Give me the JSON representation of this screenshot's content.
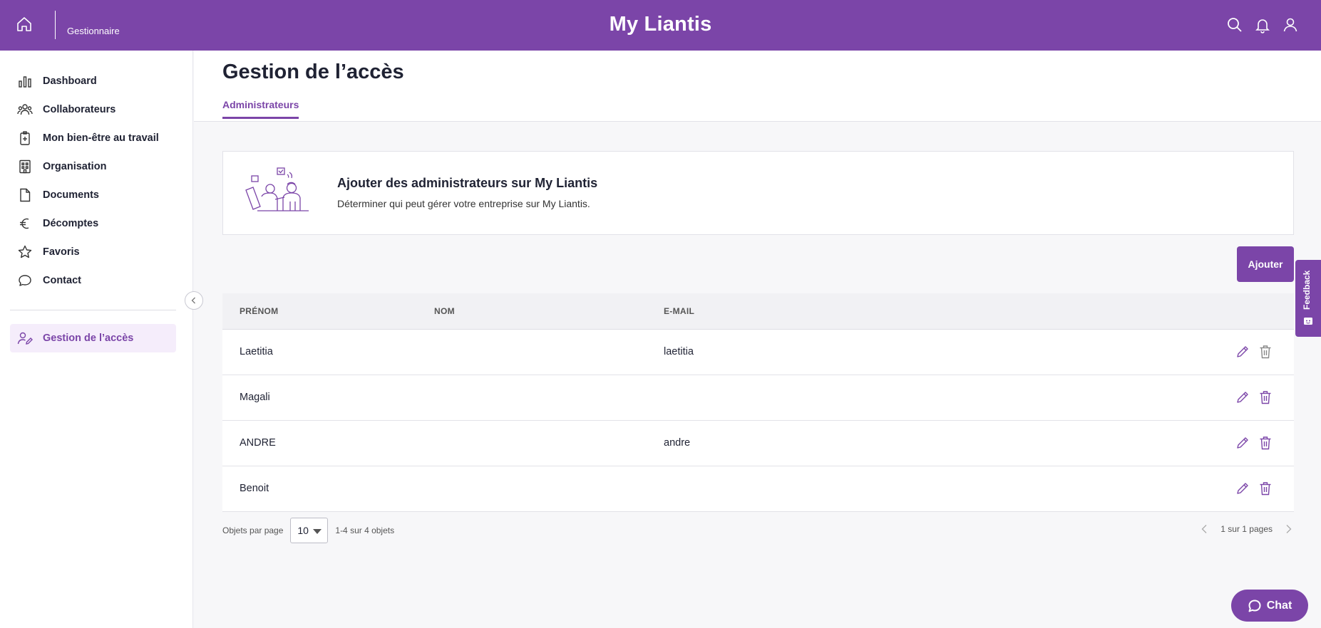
{
  "topbar": {
    "role": "Gestionnaire",
    "brand": "My Liantis"
  },
  "sidebar": {
    "items": [
      {
        "label": "Dashboard",
        "icon": "bar-chart-icon"
      },
      {
        "label": "Collaborateurs",
        "icon": "users-icon"
      },
      {
        "label": "Mon bien-être au travail",
        "icon": "badge-health-icon"
      },
      {
        "label": "Organisation",
        "icon": "building-icon"
      },
      {
        "label": "Documents",
        "icon": "document-icon"
      },
      {
        "label": "Décomptes",
        "icon": "euro-icon"
      },
      {
        "label": "Favoris",
        "icon": "star-icon"
      },
      {
        "label": "Contact",
        "icon": "speech-bubble-icon"
      }
    ],
    "active_item": {
      "label": "Gestion de l’accès",
      "icon": "user-edit-icon"
    }
  },
  "page": {
    "title": "Gestion de l’accès",
    "tab": "Administrateurs"
  },
  "card": {
    "title": "Ajouter des administrateurs sur My Liantis",
    "subtitle": "Déterminer qui peut gérer votre entreprise sur My Liantis."
  },
  "add_button": "Ajouter",
  "table": {
    "headers": {
      "first_name": "PRÉNOM",
      "last_name": "NOM",
      "email": "E-MAIL"
    },
    "rows": [
      {
        "first_name": "Laetitia",
        "last_name": "",
        "email": "laetitia"
      },
      {
        "first_name": "Magali",
        "last_name": "",
        "email": ""
      },
      {
        "first_name": "ANDRE",
        "last_name": "",
        "email": "andre"
      },
      {
        "first_name": "Benoit",
        "last_name": "",
        "email": ""
      }
    ]
  },
  "pagination": {
    "per_page_label": "Objets par page",
    "per_page_value": "10",
    "range_text": "1-4 sur 4 objets",
    "pages_text": "1 sur 1 pages"
  },
  "feedback_label": "Feedback",
  "chat_label": "Chat",
  "colors": {
    "accent": "#7b45a8",
    "active_bg": "#f5edfb"
  }
}
